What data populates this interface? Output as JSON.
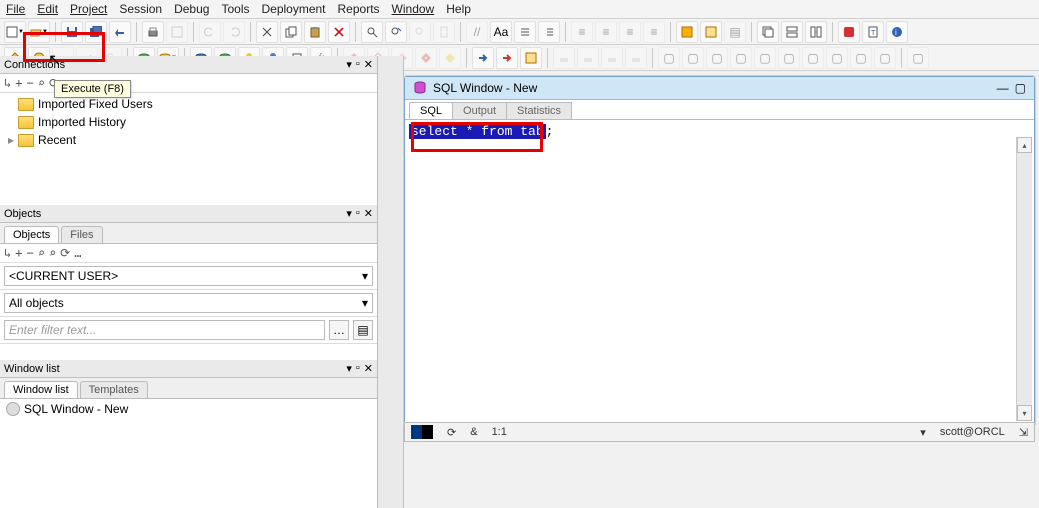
{
  "menu": {
    "items": [
      "File",
      "Edit",
      "Project",
      "Session",
      "Debug",
      "Tools",
      "Deployment",
      "Reports",
      "Window",
      "Help"
    ]
  },
  "tooltip": "Execute (F8)",
  "left": {
    "panel1": {
      "title": "Connections",
      "items": [
        {
          "label": "Imported Fixed Users"
        },
        {
          "label": "Imported History"
        },
        {
          "label": "Recent"
        }
      ]
    },
    "panel2": {
      "title": "Objects",
      "tabs": [
        "Objects",
        "Files"
      ],
      "combo1": "<CURRENT USER>",
      "combo2": "All objects",
      "filter_placeholder": "Enter filter text..."
    },
    "panel3": {
      "title": "Window list",
      "tabs": [
        "Window list",
        "Templates"
      ],
      "item": "SQL Window - New"
    }
  },
  "sql": {
    "title": "SQL Window - New",
    "tabs": [
      "SQL",
      "Output",
      "Statistics"
    ],
    "code_selected": "select * from tab",
    "code_tail": ";"
  },
  "status": {
    "pos": "1:1",
    "conn": "scott@ORCL"
  },
  "icons": {
    "amp": "&"
  }
}
